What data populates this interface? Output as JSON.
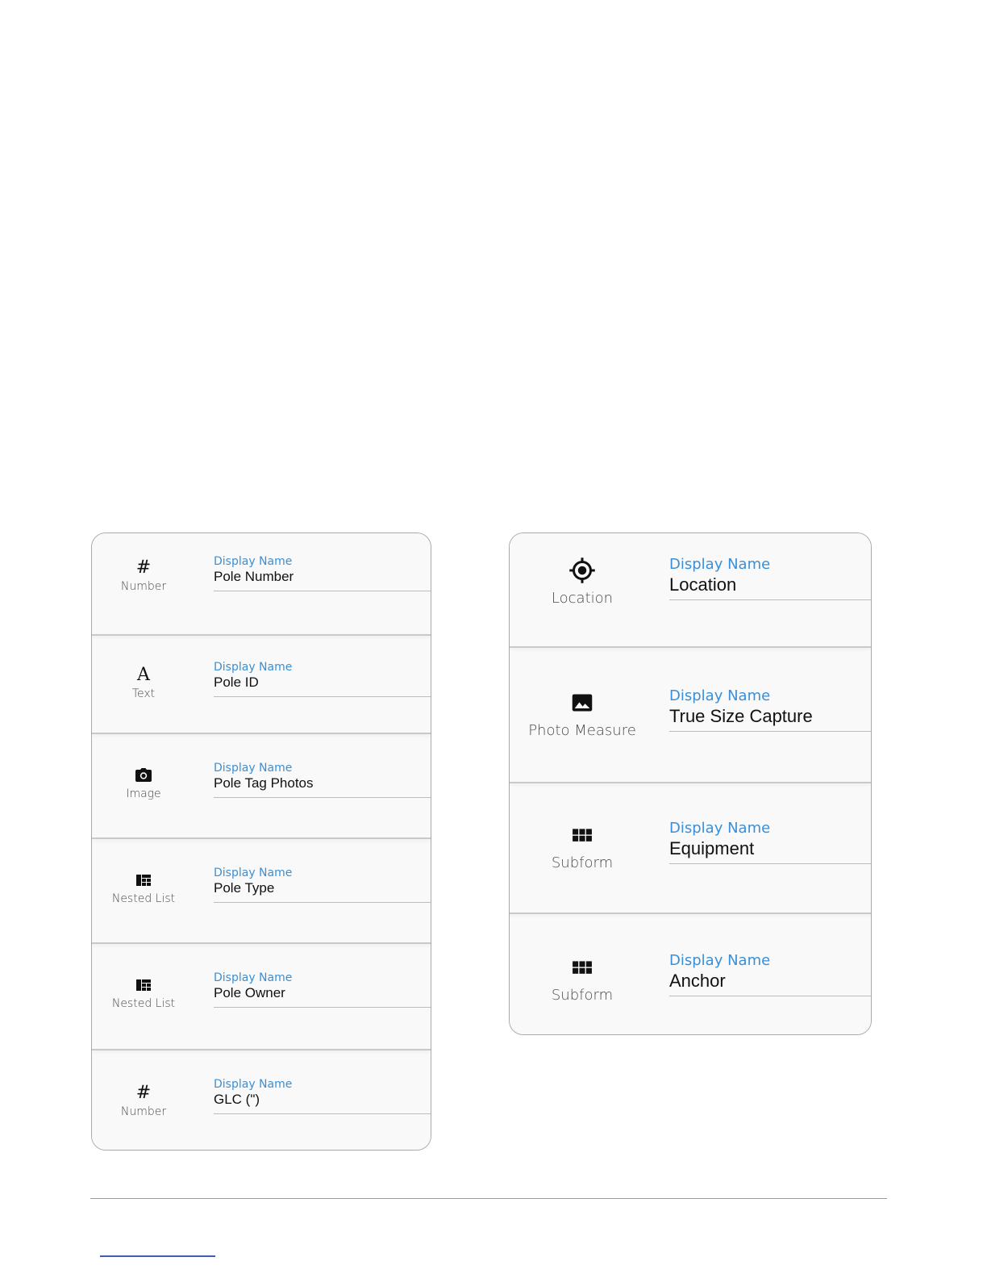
{
  "caption_label": "Display Name",
  "left_panel": {
    "rows": [
      {
        "type_label": "Number",
        "icon": "hash-icon",
        "value": "Pole Number"
      },
      {
        "type_label": "Text",
        "icon": "text-a-icon",
        "value": "Pole ID"
      },
      {
        "type_label": "Image",
        "icon": "camera-icon",
        "value": "Pole Tag Photos"
      },
      {
        "type_label": "Nested List",
        "icon": "nested-list-icon",
        "value": "Pole Type"
      },
      {
        "type_label": "Nested List",
        "icon": "nested-list-icon",
        "value": "Pole Owner"
      },
      {
        "type_label": "Number",
        "icon": "hash-icon",
        "value": "GLC (\")"
      }
    ]
  },
  "right_panel": {
    "rows": [
      {
        "type_label": "Location",
        "icon": "gps-target-icon",
        "value": "Location"
      },
      {
        "type_label": "Photo Measure",
        "icon": "photo-icon",
        "value": "True Size Capture"
      },
      {
        "type_label": "Subform",
        "icon": "grid-icon",
        "value": "Equipment"
      },
      {
        "type_label": "Subform",
        "icon": "grid-icon",
        "value": "Anchor"
      }
    ]
  },
  "colors": {
    "caption": "#3a8fd6",
    "value": "#111111",
    "panel_bg": "#f9f9f9",
    "link_rule": "#3d5fb8"
  }
}
